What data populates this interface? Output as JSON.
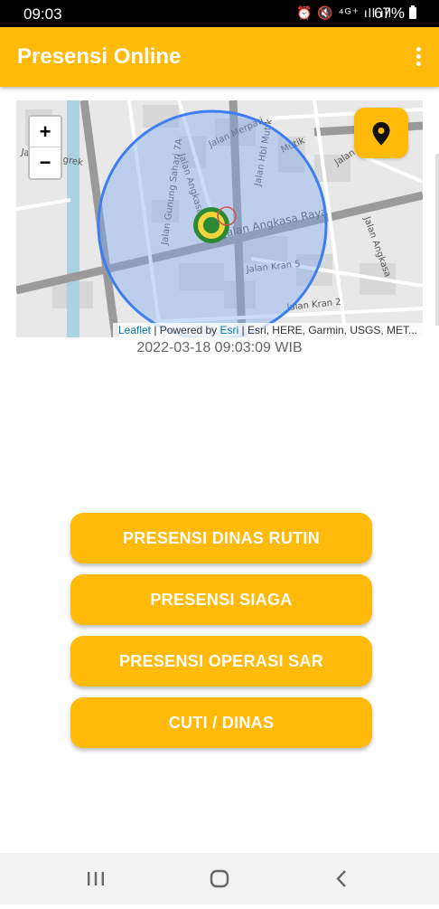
{
  "status_bar": {
    "time": "09:03",
    "icons": "⏰ 🔇 ⁴ᴳ⁺ ıll ıll",
    "battery": "67%"
  },
  "app_bar": {
    "title": "Presensi Online",
    "menu_icon": "more-vert-icon"
  },
  "map": {
    "zoom_in": "+",
    "zoom_out": "−",
    "locate_icon": "map-marker-icon",
    "streets": [
      "Jalan Merpati Mutik",
      "Jalan Hbl Mutik",
      "Jalan Rendani",
      "Jalan Angkasa Raya",
      "Jalan Angkasa",
      "Jalan Kran 5",
      "Jalan Kran 2",
      "Jalan Gunung Sahari 7A",
      "Jalan Angkasa 5"
    ],
    "attribution": {
      "leaflet": "Leaflet",
      "sep1": " | Powered by ",
      "esri": "Esri",
      "rest": " | Esri, HERE, Garmin, USGS, MET..."
    },
    "colors": {
      "radius_fill": "#7aa8f0",
      "radius_stroke": "#3d7ef0"
    }
  },
  "timestamp": "2022-03-18 09:03:09 WIB",
  "actions": [
    {
      "label": "PRESENSI DINAS RUTIN"
    },
    {
      "label": "PRESENSI SIAGA"
    },
    {
      "label": "PRESENSI OPERASI SAR"
    },
    {
      "label": "CUTI / DINAS"
    }
  ],
  "nav_bar": {
    "recents": "recents-icon",
    "home": "home-icon",
    "back": "back-icon"
  },
  "colors": {
    "accent": "#ffba0a"
  }
}
